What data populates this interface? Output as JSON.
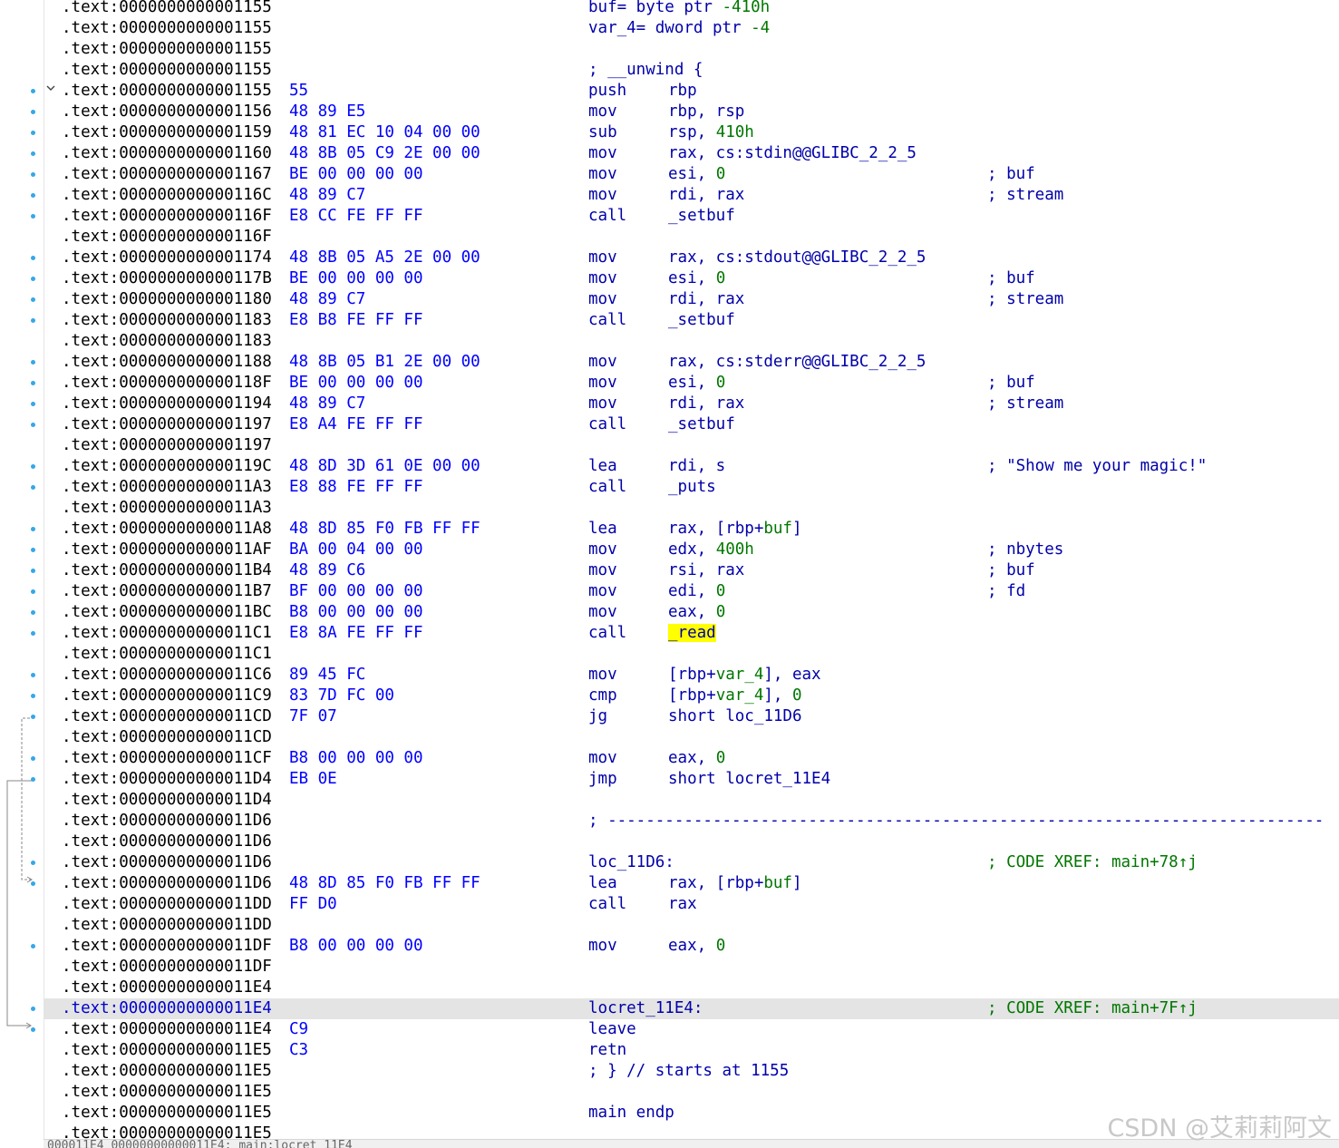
{
  "header_vars": [
    {
      "addr": ".text:0000000000001155",
      "text": "buf= byte ptr -410h"
    },
    {
      "addr": ".text:0000000000001155",
      "text": "var_4= dword ptr -4"
    },
    {
      "addr": ".text:0000000000001155",
      "text": ""
    },
    {
      "addr": ".text:0000000000001155",
      "text": "; __unwind {"
    }
  ],
  "rows": [
    {
      "addr": ".text:0000000000001155",
      "bytes": "55",
      "mn": "push",
      "ops": "rbp",
      "cmt": ""
    },
    {
      "addr": ".text:0000000000001156",
      "bytes": "48 89 E5",
      "mn": "mov",
      "ops": "rbp, rsp",
      "cmt": ""
    },
    {
      "addr": ".text:0000000000001159",
      "bytes": "48 81 EC 10 04 00 00",
      "mn": "sub",
      "ops": "rsp, 410h",
      "cmt": ""
    },
    {
      "addr": ".text:0000000000001160",
      "bytes": "48 8B 05 C9 2E 00 00",
      "mn": "mov",
      "ops": "rax, cs:stdin@@GLIBC_2_2_5",
      "cmt": ""
    },
    {
      "addr": ".text:0000000000001167",
      "bytes": "BE 00 00 00 00",
      "mn": "mov",
      "ops": "esi, 0",
      "cmt": "; buf"
    },
    {
      "addr": ".text:000000000000116C",
      "bytes": "48 89 C7",
      "mn": "mov",
      "ops": "rdi, rax",
      "cmt": "; stream"
    },
    {
      "addr": ".text:000000000000116F",
      "bytes": "E8 CC FE FF FF",
      "mn": "call",
      "ops": "_setbuf",
      "cmt": ""
    },
    {
      "addr": ".text:000000000000116F",
      "bytes": "",
      "mn": "",
      "ops": "",
      "cmt": ""
    },
    {
      "addr": ".text:0000000000001174",
      "bytes": "48 8B 05 A5 2E 00 00",
      "mn": "mov",
      "ops": "rax, cs:stdout@@GLIBC_2_2_5",
      "cmt": ""
    },
    {
      "addr": ".text:000000000000117B",
      "bytes": "BE 00 00 00 00",
      "mn": "mov",
      "ops": "esi, 0",
      "cmt": "; buf"
    },
    {
      "addr": ".text:0000000000001180",
      "bytes": "48 89 C7",
      "mn": "mov",
      "ops": "rdi, rax",
      "cmt": "; stream"
    },
    {
      "addr": ".text:0000000000001183",
      "bytes": "E8 B8 FE FF FF",
      "mn": "call",
      "ops": "_setbuf",
      "cmt": ""
    },
    {
      "addr": ".text:0000000000001183",
      "bytes": "",
      "mn": "",
      "ops": "",
      "cmt": ""
    },
    {
      "addr": ".text:0000000000001188",
      "bytes": "48 8B 05 B1 2E 00 00",
      "mn": "mov",
      "ops": "rax, cs:stderr@@GLIBC_2_2_5",
      "cmt": ""
    },
    {
      "addr": ".text:000000000000118F",
      "bytes": "BE 00 00 00 00",
      "mn": "mov",
      "ops": "esi, 0",
      "cmt": "; buf"
    },
    {
      "addr": ".text:0000000000001194",
      "bytes": "48 89 C7",
      "mn": "mov",
      "ops": "rdi, rax",
      "cmt": "; stream"
    },
    {
      "addr": ".text:0000000000001197",
      "bytes": "E8 A4 FE FF FF",
      "mn": "call",
      "ops": "_setbuf",
      "cmt": ""
    },
    {
      "addr": ".text:0000000000001197",
      "bytes": "",
      "mn": "",
      "ops": "",
      "cmt": ""
    },
    {
      "addr": ".text:000000000000119C",
      "bytes": "48 8D 3D 61 0E 00 00",
      "mn": "lea",
      "ops": "rdi, s",
      "cmt": "; \"Show me your magic!\""
    },
    {
      "addr": ".text:00000000000011A3",
      "bytes": "E8 88 FE FF FF",
      "mn": "call",
      "ops": "_puts",
      "cmt": ""
    },
    {
      "addr": ".text:00000000000011A3",
      "bytes": "",
      "mn": "",
      "ops": "",
      "cmt": ""
    },
    {
      "addr": ".text:00000000000011A8",
      "bytes": "48 8D 85 F0 FB FF FF",
      "mn": "lea",
      "ops": "rax, [rbp+buf]",
      "cmt": ""
    },
    {
      "addr": ".text:00000000000011AF",
      "bytes": "BA 00 04 00 00",
      "mn": "mov",
      "ops": "edx, 400h",
      "cmt": "; nbytes"
    },
    {
      "addr": ".text:00000000000011B4",
      "bytes": "48 89 C6",
      "mn": "mov",
      "ops": "rsi, rax",
      "cmt": "; buf"
    },
    {
      "addr": ".text:00000000000011B7",
      "bytes": "BF 00 00 00 00",
      "mn": "mov",
      "ops": "edi, 0",
      "cmt": "; fd"
    },
    {
      "addr": ".text:00000000000011BC",
      "bytes": "B8 00 00 00 00",
      "mn": "mov",
      "ops": "eax, 0",
      "cmt": ""
    },
    {
      "addr": ".text:00000000000011C1",
      "bytes": "E8 8A FE FF FF",
      "mn": "call",
      "ops": "_read",
      "cmt": "",
      "highlight_op": true
    },
    {
      "addr": ".text:00000000000011C1",
      "bytes": "",
      "mn": "",
      "ops": "",
      "cmt": ""
    },
    {
      "addr": ".text:00000000000011C6",
      "bytes": "89 45 FC",
      "mn": "mov",
      "ops": "[rbp+var_4], eax",
      "cmt": ""
    },
    {
      "addr": ".text:00000000000011C9",
      "bytes": "83 7D FC 00",
      "mn": "cmp",
      "ops": "[rbp+var_4], 0",
      "cmt": ""
    },
    {
      "addr": ".text:00000000000011CD",
      "bytes": "7F 07",
      "mn": "jg",
      "ops": "short loc_11D6",
      "cmt": ""
    },
    {
      "addr": ".text:00000000000011CD",
      "bytes": "",
      "mn": "",
      "ops": "",
      "cmt": ""
    },
    {
      "addr": ".text:00000000000011CF",
      "bytes": "B8 00 00 00 00",
      "mn": "mov",
      "ops": "eax, 0",
      "cmt": ""
    },
    {
      "addr": ".text:00000000000011D4",
      "bytes": "EB 0E",
      "mn": "jmp",
      "ops": "short locret_11E4",
      "cmt": ""
    },
    {
      "addr": ".text:00000000000011D4",
      "bytes": "",
      "mn": "",
      "ops": "",
      "cmt": ""
    },
    {
      "addr": ".text:00000000000011D6",
      "bytes": "",
      "mn": "",
      "ops": "",
      "cmt": "",
      "separator": "; ---------------------------------------------------------------------------"
    },
    {
      "addr": ".text:00000000000011D6",
      "bytes": "",
      "mn": "",
      "ops": "",
      "cmt": ""
    },
    {
      "addr": ".text:00000000000011D6",
      "bytes": "",
      "mn": "",
      "ops": "",
      "cmt": "; CODE XREF: main+78↑j",
      "label": "loc_11D6:"
    },
    {
      "addr": ".text:00000000000011D6",
      "bytes": "48 8D 85 F0 FB FF FF",
      "mn": "lea",
      "ops": "rax, [rbp+buf]",
      "cmt": ""
    },
    {
      "addr": ".text:00000000000011DD",
      "bytes": "FF D0",
      "mn": "call",
      "ops": "rax",
      "cmt": ""
    },
    {
      "addr": ".text:00000000000011DD",
      "bytes": "",
      "mn": "",
      "ops": "",
      "cmt": ""
    },
    {
      "addr": ".text:00000000000011DF",
      "bytes": "B8 00 00 00 00",
      "mn": "mov",
      "ops": "eax, 0",
      "cmt": ""
    },
    {
      "addr": ".text:00000000000011DF",
      "bytes": "",
      "mn": "",
      "ops": "",
      "cmt": ""
    },
    {
      "addr": ".text:00000000000011E4",
      "bytes": "",
      "mn": "",
      "ops": "",
      "cmt": ""
    },
    {
      "addr": ".text:00000000000011E4",
      "bytes": "",
      "mn": "",
      "ops": "",
      "cmt": "; CODE XREF: main+7F↑j",
      "label": "locret_11E4:",
      "selected": true
    },
    {
      "addr": ".text:00000000000011E4",
      "bytes": "C9",
      "mn": "leave",
      "ops": "",
      "cmt": ""
    },
    {
      "addr": ".text:00000000000011E5",
      "bytes": "C3",
      "mn": "retn",
      "ops": "",
      "cmt": ""
    },
    {
      "addr": ".text:00000000000011E5",
      "bytes": "",
      "mn": "",
      "ops": "",
      "cmt": "",
      "label": "; } // starts at 1155"
    },
    {
      "addr": ".text:00000000000011E5",
      "bytes": "",
      "mn": "",
      "ops": "",
      "cmt": ""
    },
    {
      "addr": ".text:00000000000011E5",
      "bytes": "",
      "mn": "",
      "ops": "",
      "cmt": "",
      "label": "main endp"
    },
    {
      "addr": ".text:00000000000011E5",
      "bytes": "",
      "mn": "",
      "ops": "",
      "cmt": ""
    }
  ],
  "dot_rows": [
    4,
    5,
    6,
    7,
    8,
    9,
    10,
    12,
    13,
    14,
    15,
    17,
    18,
    19,
    20,
    22,
    23,
    25,
    26,
    27,
    28,
    29,
    30,
    32,
    33,
    34,
    36,
    37,
    41,
    42,
    45,
    48,
    49
  ],
  "status_text": "000011E4 00000000000011E4: main:locret_11E4",
  "watermark": "CSDN @艾莉莉阿文",
  "colors": {
    "address": "#000000",
    "bytes": "#0000ff",
    "code": "#0000aa",
    "number": "#007700",
    "comment_xref": "#007700",
    "highlight": "#ffff00",
    "selected_row": "#e4e4e4",
    "gutter_dot": "#35a7e8"
  }
}
